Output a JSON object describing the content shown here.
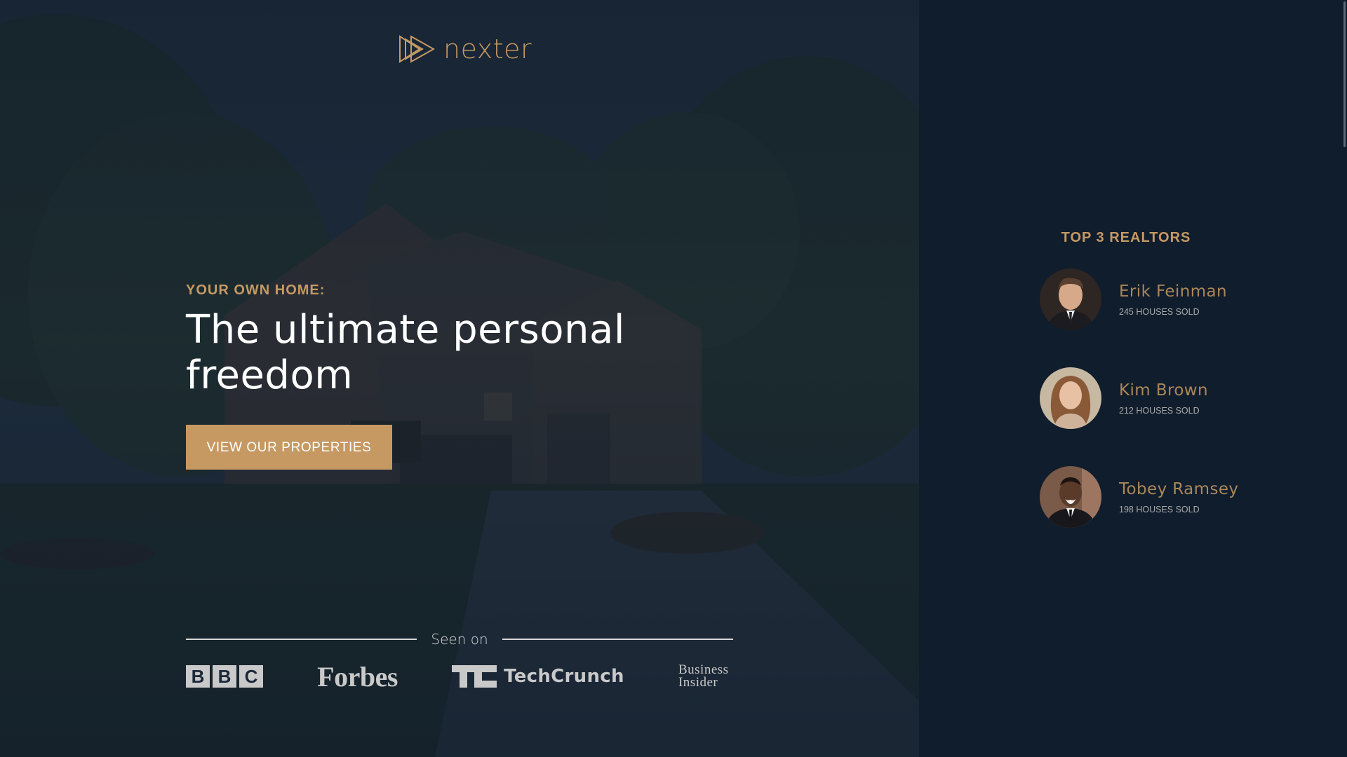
{
  "brand": {
    "name": "nexter",
    "accent_color": "#c69963",
    "background_color": "#101d2c"
  },
  "hero": {
    "subtitle": "YOUR OWN HOME:",
    "title": "The ultimate personal freedom",
    "cta_label": "VIEW OUR PROPERTIES",
    "seen_on_label": "Seen on",
    "press": {
      "bbc": [
        "B",
        "B",
        "C"
      ],
      "forbes": "Forbes",
      "techcrunch": "TechCrunch",
      "business_insider": [
        "Business",
        "Insider"
      ]
    }
  },
  "realtors": {
    "heading": "TOP 3 REALTORS",
    "items": [
      {
        "name": "Erik Feinman",
        "sold": "245 HOUSES SOLD"
      },
      {
        "name": "Kim Brown",
        "sold": "212 HOUSES SOLD"
      },
      {
        "name": "Tobey Ramsey",
        "sold": "198 HOUSES SOLD"
      }
    ]
  }
}
